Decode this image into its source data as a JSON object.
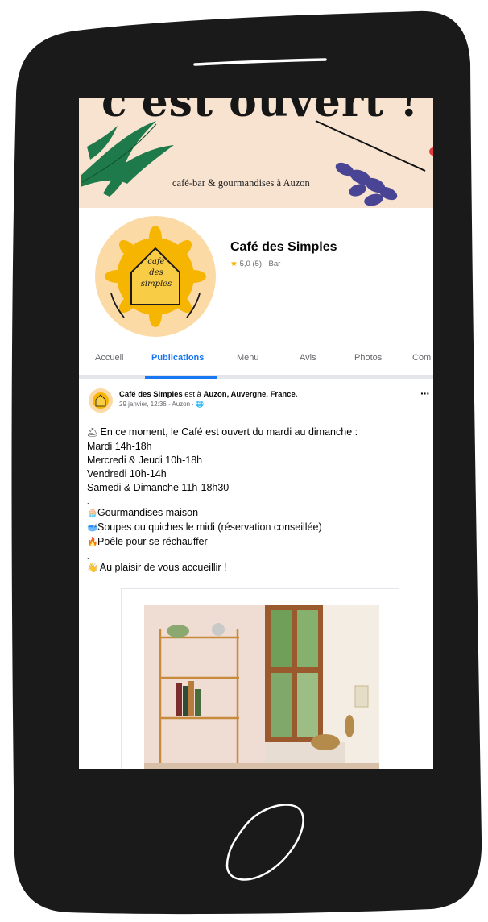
{
  "cover": {
    "title": "c'est ouvert !",
    "tagline": "café-bar & gourmandises à Auzon"
  },
  "profile": {
    "logo_lines": [
      "café",
      "des",
      "simples"
    ],
    "name": "Café des Simples",
    "rating": "5,0 (5) · Bar"
  },
  "tabs": [
    {
      "label": "Accueil",
      "active": false
    },
    {
      "label": "Publications",
      "active": true
    },
    {
      "label": "Menu",
      "active": false
    },
    {
      "label": "Avis",
      "active": false
    },
    {
      "label": "Photos",
      "active": false
    },
    {
      "label": "Com",
      "active": false
    }
  ],
  "post": {
    "author": "Café des Simples",
    "connector": " est à ",
    "location": "Auzon, Auvergne, France.",
    "meta": "29 janvier, 12:36 · Auzon · 🌐",
    "more": "···",
    "lines": [
      {
        "emoji": "🛎",
        "text": "En ce moment, le Café est ouvert du mardi au dimanche :"
      },
      {
        "emoji": "",
        "text": "Mardi 14h-18h"
      },
      {
        "emoji": "",
        "text": "Mercredi & Jeudi 10h-18h"
      },
      {
        "emoji": "",
        "text": "Vendredi 10h-14h"
      },
      {
        "emoji": "",
        "text": "Samedi & Dimanche 11h-18h30"
      },
      {
        "emoji": "",
        "text": "."
      },
      {
        "emoji": "🧁",
        "text": "Gourmandises maison"
      },
      {
        "emoji": "🥣",
        "text": "Soupes ou quiches le midi (réservation conseillée)"
      },
      {
        "emoji": "🔥",
        "text": "Poêle pour se réchauffer"
      },
      {
        "emoji": "",
        "text": "."
      },
      {
        "emoji": "👋",
        "text": "Au plaisir de vous accueillir !"
      }
    ]
  },
  "colors": {
    "accent": "#1877f2",
    "phone": "#1a1a1a",
    "cover_bg": "#f7e3d0",
    "logo_bg": "#fcdaa6"
  },
  "icons": [
    "star-icon",
    "more-icon",
    "home-button-icon",
    "speaker-slot-icon"
  ]
}
